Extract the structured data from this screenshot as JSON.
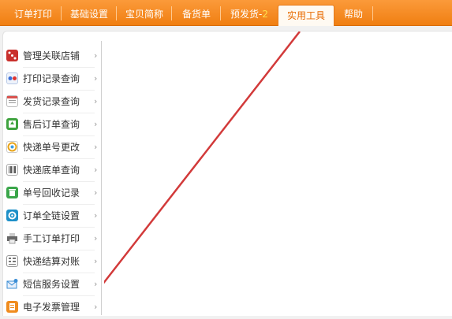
{
  "tabs": [
    {
      "label": "订单打印",
      "badge": ""
    },
    {
      "label": "基础设置",
      "badge": ""
    },
    {
      "label": "宝贝简称",
      "badge": ""
    },
    {
      "label": "备货单",
      "badge": ""
    },
    {
      "label": "预发货-",
      "badge": "2"
    },
    {
      "label": "实用工具",
      "badge": "",
      "active": true
    },
    {
      "label": "帮助",
      "badge": ""
    }
  ],
  "sidebar": {
    "items": [
      {
        "label": "管理关联店铺",
        "icon": "linked-shops-icon",
        "color": "#c9302c"
      },
      {
        "label": "打印记录查询",
        "icon": "print-records-icon",
        "color": "#3a6fd8"
      },
      {
        "label": "发货记录查询",
        "icon": "shipping-records-icon",
        "color": "#d9534f"
      },
      {
        "label": "售后订单查询",
        "icon": "after-sales-icon",
        "color": "#3fa33f"
      },
      {
        "label": "快递单号更改",
        "icon": "tracking-change-icon",
        "color": "#e8a317"
      },
      {
        "label": "快递底单查询",
        "icon": "waybill-query-icon",
        "color": "#888888"
      },
      {
        "label": "单号回收记录",
        "icon": "recycle-icon",
        "color": "#3aa64a"
      },
      {
        "label": "订单全链设置",
        "icon": "gear-icon",
        "color": "#1e90c8"
      },
      {
        "label": "手工订单打印",
        "icon": "printer-icon",
        "color": "#666666"
      },
      {
        "label": "快递结算对账",
        "icon": "ledger-icon",
        "color": "#777777"
      },
      {
        "label": "短信服务设置",
        "icon": "sms-icon",
        "color": "#3d8fd6"
      },
      {
        "label": "电子发票管理",
        "icon": "invoice-icon",
        "color": "#f08c1e"
      }
    ]
  },
  "colors": {
    "accent": "#f07f12",
    "active_tab_text": "#e86b00",
    "stroke": "#d23a3a"
  }
}
